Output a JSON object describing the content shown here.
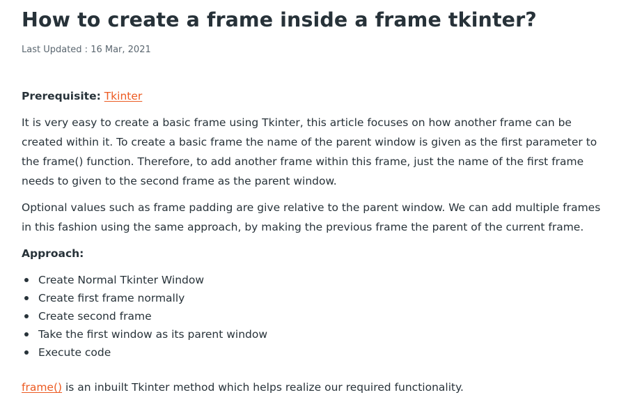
{
  "article": {
    "title": "How to create a frame inside a frame tkinter?",
    "last_updated": "Last Updated : 16 Mar, 2021",
    "prerequisite": {
      "label": "Prerequisite:",
      "link_text": "Tkinter"
    },
    "paragraph1": {
      "text_a": "It is very easy to create a basic frame using Tkinter, this article focuses on how another frame can be created within it. To create a basic frame the name of the parent window is given as the first parameter to the ",
      "code": "frame()",
      "text_b": " function. Therefore, to add another frame within this frame, just the name of the first frame needs to given to the second frame as the parent window."
    },
    "paragraph2": "Optional values such as frame padding are give relative to the parent window. We can add multiple frames in this fashion using the same approach, by making the previous frame the parent of the current frame.",
    "approach_heading": "Approach:",
    "steps": [
      "Create Normal Tkinter Window",
      "Create first frame normally",
      "Create second frame",
      "Take the first window as its parent window",
      "Execute code"
    ],
    "final": {
      "link_text": "frame()",
      "text": " is an inbuilt Tkinter method which helps realize our required functionality."
    }
  }
}
